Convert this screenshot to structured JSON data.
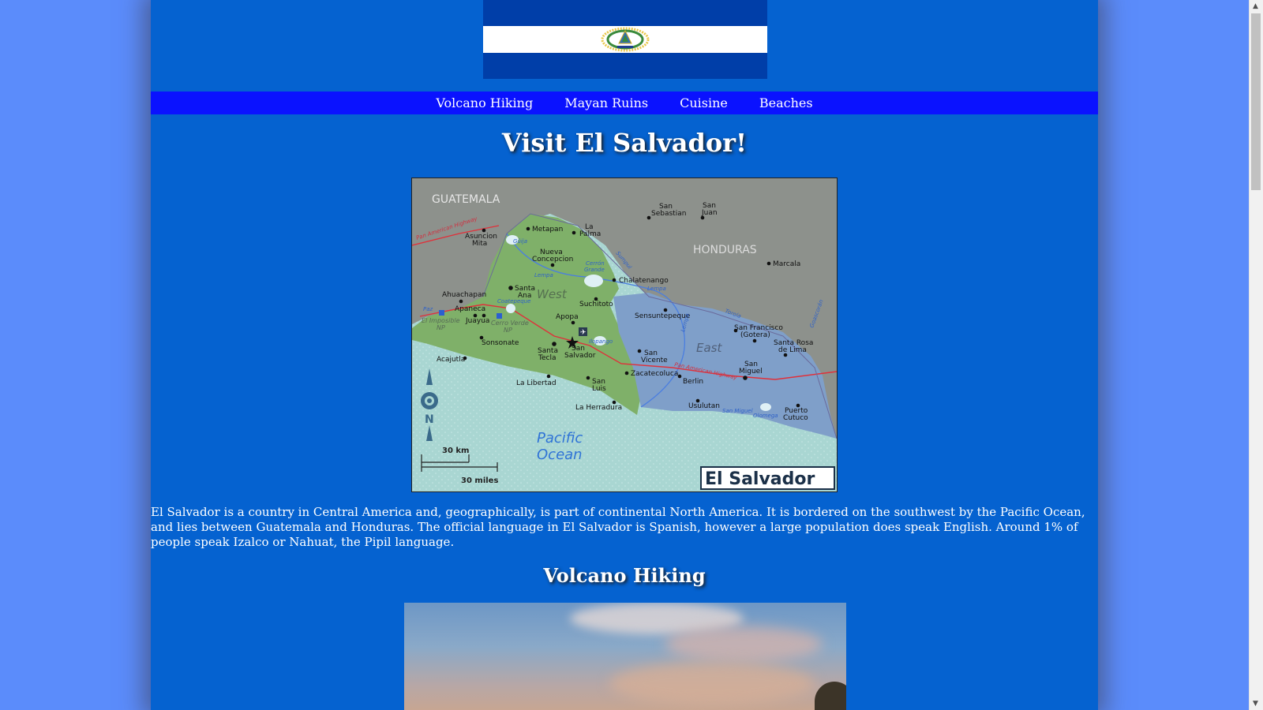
{
  "nav": {
    "items": [
      {
        "label": "Volcano Hiking"
      },
      {
        "label": "Mayan Ruins"
      },
      {
        "label": "Cuisine"
      },
      {
        "label": "Beaches"
      }
    ]
  },
  "main": {
    "title": "Visit El Salvador!",
    "intro": "El Salvador is a country in Central America and, geographically, is part of continental North America. It is bordered on the southwest by the Pacific Ocean, and lies between Guatemala and Honduras. The official language in El Salvador is Spanish, however a large population does speak English. Around 1% of people speak Izalco or Nahuat, the Pipil language.",
    "section_title": "Volcano Hiking"
  },
  "map": {
    "countries": {
      "guatemala": "GUATEMALA",
      "honduras": "HONDURAS"
    },
    "regions": {
      "west": "West",
      "east": "East"
    },
    "ocean": [
      "Pacific",
      "Ocean"
    ],
    "badge": "El Salvador",
    "scale_km": "30 km",
    "scale_miles": "30 miles",
    "north": "N",
    "cities": {
      "metapan": "Metapan",
      "la_palma": "La",
      "la_palma2": "Palma",
      "asuncion": "Asuncion",
      "mita": "Mita",
      "nueva": "Nueva",
      "concepcion": "Concepcion",
      "san_sebastian": "San",
      "san_sebastian2": "Sebastian",
      "san_juan": "San",
      "san_juan2": "Juan",
      "marcala": "Marcala",
      "chalatenango": "Chalatenango",
      "ahuachapan": "Ahuachapan",
      "santa_ana": "Santa",
      "santa_ana2": "Ana",
      "apaneca": "Apaneca",
      "juayua": "Juayua",
      "suchitoto": "Suchitoto",
      "sensuntepeque": "Sensuntepeque",
      "apopa": "Apopa",
      "sonsonate": "Sonsonate",
      "santa_tecla": "Santa",
      "santa_tecla2": "Tecla",
      "san_salvador": "San",
      "san_salvador2": "Salvador",
      "acajutla": "Acajutla",
      "san_vicente": "San",
      "san_vicente2": "Vicente",
      "san_francisco": "San Francisco",
      "gotera": "(Gotera)",
      "santa_rosa": "Santa Rosa",
      "de_lima": "de Lima",
      "san_miguel": "San",
      "san_miguel2": "Miguel",
      "zacatecoluca": "Zacatecoluca",
      "berlin": "Berlin",
      "la_libertad": "La Libertad",
      "san_luis": "San",
      "san_luis2": "Luis",
      "la_herradura": "La Herradura",
      "usulutan": "Usulutan",
      "puerto": "Puerto",
      "cutuco": "Cutuco"
    },
    "parks": {
      "el_imposible": "El Imposible",
      "np1": "NP",
      "cerro_verde": "Cerro Verde",
      "np2": "NP"
    },
    "water": {
      "pan_american_w": "Pan American Highway",
      "pan_american_e": "Pan American Highway",
      "guija": "Güija",
      "lempa1": "Lempa",
      "lempa2": "Lempa",
      "lempa3": "Lempa",
      "cerron_grande": "Cerrón",
      "cerron_grande2": "Grande",
      "coatepeque": "Coatepeque",
      "ilopango": "Ilopango",
      "sumpul": "Sumpul",
      "torola": "Torola",
      "goascoran": "Goascorán",
      "paz": "Paz",
      "olomega": "Olomega",
      "san_miguel_river": "San Miguel"
    }
  },
  "colors": {
    "page_bg": "#5b8cfb",
    "container_bg": "#0562d0",
    "nav_bg": "#0a12ff",
    "flag_blue": "#003ea8",
    "map_west": "#7fb069",
    "map_east": "#7f9fc9",
    "map_ocean": "#a8d4d0"
  },
  "icons": {
    "emblem": "coat-of-arms-icon",
    "compass": "compass-rose-icon",
    "airport": "airport-icon",
    "capital": "capital-star-icon"
  }
}
